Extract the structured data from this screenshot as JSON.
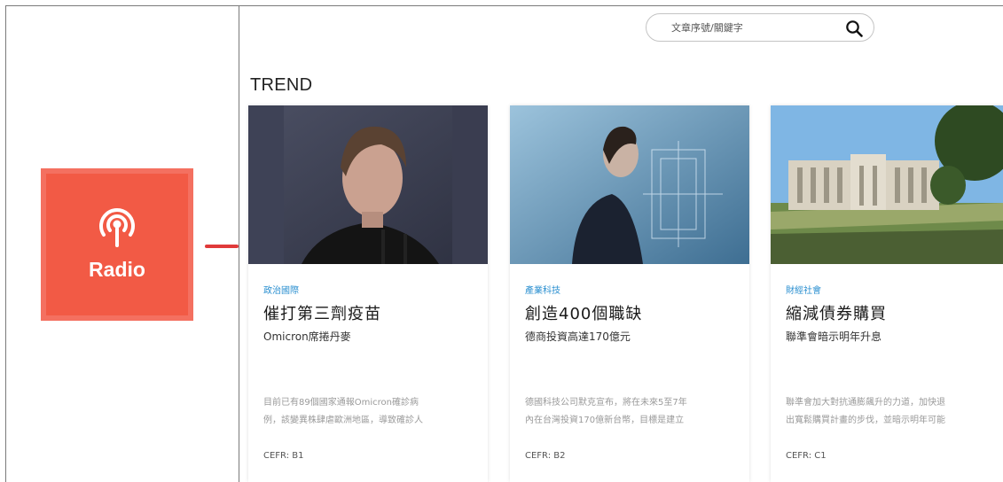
{
  "sidebar": {
    "radio_label": "Radio",
    "accent_color": "#f25a45",
    "icon": "radio-antenna-icon"
  },
  "search": {
    "placeholder": "文章序號/關鍵字",
    "icon": "search-icon"
  },
  "main": {
    "section_title": "TREND",
    "cards": [
      {
        "category": "政治國際",
        "title": "催打第三劑疫苗",
        "subtitle": "Omicron席捲丹麥",
        "desc_line1": "目前已有89個國家通報Omicron確診病",
        "desc_line2": "例，該變異株肆虐歐洲地區，導致確診人",
        "cefr": "CEFR: B1"
      },
      {
        "category": "產業科技",
        "title": "創造400個職缺",
        "subtitle": "德商投資高達170億元",
        "desc_line1": "德國科技公司默克宣布，將在未來5至7年",
        "desc_line2": "內在台灣投資170億新台幣，目標是建立",
        "cefr": "CEFR: B2"
      },
      {
        "category": "財經社會",
        "title": "縮減債券購買",
        "subtitle": "聯準會暗示明年升息",
        "desc_line1": "聯準會加大對抗通膨飆升的力道，加快退",
        "desc_line2": "出寬鬆購買計畫的步伐，並暗示明年可能",
        "cefr": "CEFR: C1"
      }
    ]
  }
}
